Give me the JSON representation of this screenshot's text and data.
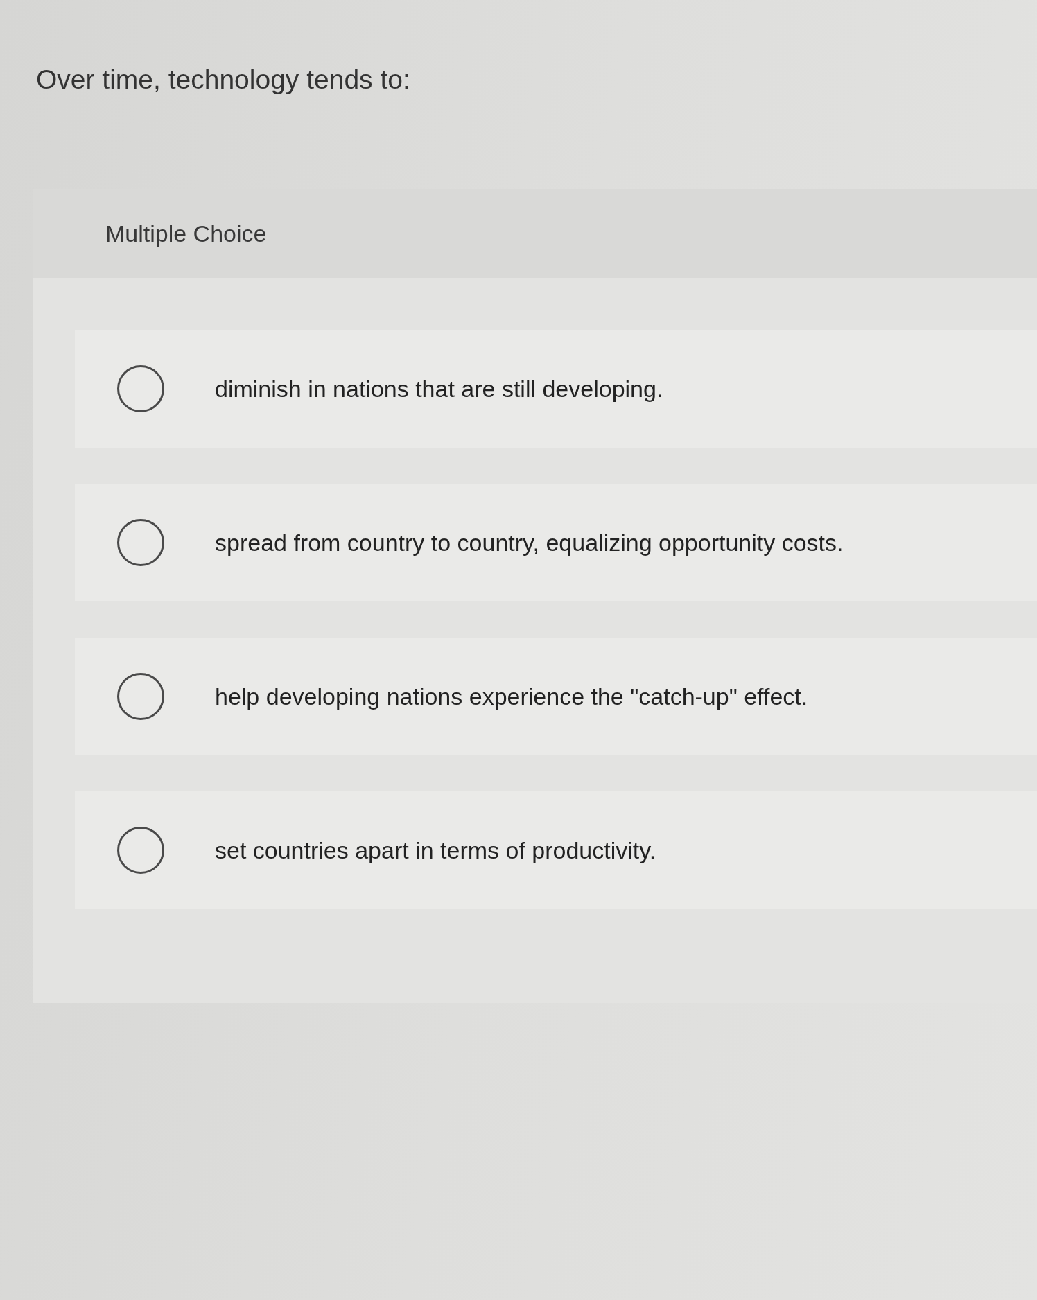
{
  "question": "Over time, technology tends to:",
  "panel": {
    "header": "Multiple Choice",
    "options": [
      {
        "label": "diminish in nations that are still developing.",
        "selected": false
      },
      {
        "label": "spread from country to country, equalizing opportunity costs.",
        "selected": false
      },
      {
        "label": "help developing nations experience the \"catch-up\" effect.",
        "selected": false
      },
      {
        "label": "set countries apart in terms of productivity.",
        "selected": false
      }
    ]
  }
}
